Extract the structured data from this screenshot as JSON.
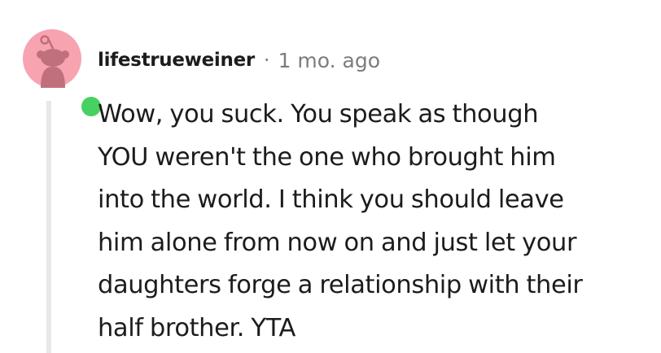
{
  "comment": {
    "author": "lifestrueweiner",
    "separator": "·",
    "timestamp": "1 mo. ago",
    "avatar_icon": "snoo-avatar-icon",
    "online_status": "online",
    "colors": {
      "avatar_background": "#f8a3b0",
      "online_dot": "#46d160",
      "thread_line": "#e8e8e8",
      "meta_text": "#7c7c7c",
      "body_text": "#1c1c1c"
    },
    "body_lines": [
      "Wow, you suck. You speak as though",
      "YOU weren't the one who brought him",
      "into the world. I think you should leave",
      "him alone from now on and just let your",
      "daughters forge a relationship with their",
      "half brother. YTA"
    ]
  }
}
